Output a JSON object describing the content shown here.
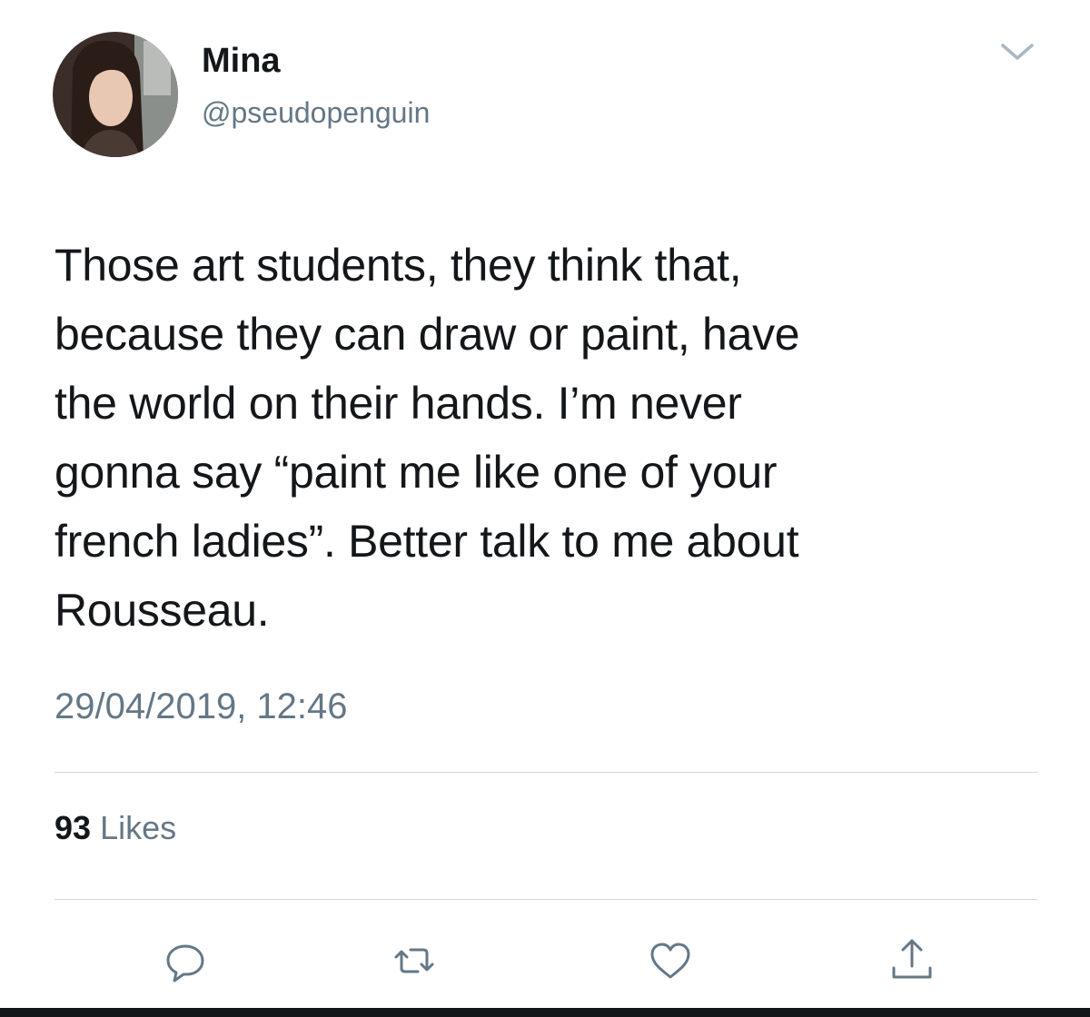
{
  "user": {
    "display_name": "Mina",
    "handle": "@pseudopenguin"
  },
  "tweet": {
    "text": "Those art students, they think that,\nbecause they can draw or paint, have\nthe world on their hands. I’m never\ngonna say “paint me like one of your\nfrench ladies”. Better talk to me about\nRousseau.",
    "timestamp": "29/04/2019, 12:46"
  },
  "stats": {
    "likes_count": "93",
    "likes_label": "Likes"
  },
  "icons": {
    "menu": "chevron-down-icon",
    "reply": "reply-icon",
    "retweet": "retweet-icon",
    "like": "heart-icon",
    "share": "share-icon"
  },
  "colors": {
    "text_primary": "#14171a",
    "text_secondary": "#657786",
    "divider": "#ccd6dd"
  }
}
